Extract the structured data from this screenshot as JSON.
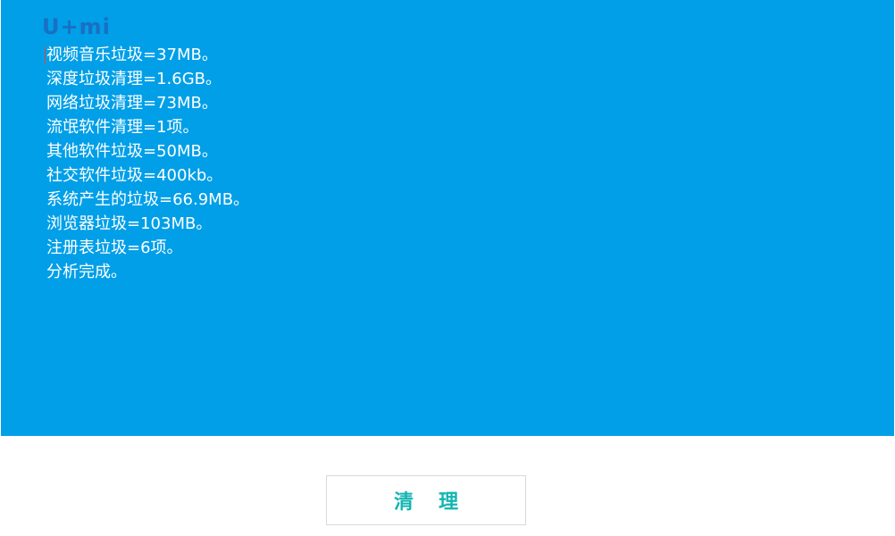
{
  "brand": {
    "logo_text": "U+mi",
    "logo_color": "#1a6fc4"
  },
  "colors": {
    "panel_background": "#009fe8",
    "log_text": "#ffffff",
    "button_text": "#13b5b1",
    "button_border": "#d9d9d9"
  },
  "log": {
    "lines": [
      "视频音乐垃圾=37MB。",
      "深度垃圾清理=1.6GB。",
      "网络垃圾清理=73MB。",
      "流氓软件清理=1项。",
      "其他软件垃圾=50MB。",
      "社交软件垃圾=400kb。",
      "系统产生的垃圾=66.9MB。",
      "浏览器垃圾=103MB。",
      "注册表垃圾=6项。",
      "分析完成。"
    ]
  },
  "actions": {
    "clean_label": "清理"
  }
}
